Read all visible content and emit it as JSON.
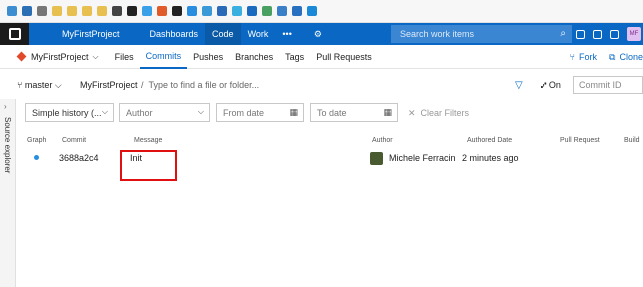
{
  "topnav": {
    "project": "MyFirstProject",
    "items": [
      "Dashboards",
      "Code",
      "Work",
      "•••"
    ],
    "active": "Code",
    "search_placeholder": "Search work items",
    "avatar_initials": "MF",
    "accent": "#0a68c4"
  },
  "subnav": {
    "project": "MyFirstProject",
    "tabs": [
      "Files",
      "Commits",
      "Pushes",
      "Branches",
      "Tags",
      "Pull Requests"
    ],
    "active_tab": "Commits",
    "fork": "Fork",
    "clone": "Clone"
  },
  "pathrow": {
    "branch": "master",
    "repo": "MyFirstProject",
    "separator": "/",
    "path_hint": "Type to find a file or folder...",
    "on_label": "On",
    "commit_id_placeholder": "Commit ID"
  },
  "sidebar": {
    "label": "Source explorer"
  },
  "filters": {
    "history": "Simple history (...",
    "author": "Author",
    "from_date": "From date",
    "to_date": "To date",
    "clear": "Clear Filters"
  },
  "table": {
    "headers": {
      "graph": "Graph",
      "commit": "Commit",
      "message": "Message",
      "author": "Author",
      "authored_date": "Authored Date",
      "pull_request": "Pull Request",
      "build": "Build"
    },
    "rows": [
      {
        "commit": "3688a2c4",
        "message": "Init",
        "author": "Michele Ferracin",
        "date": "2 minutes ago"
      }
    ]
  }
}
